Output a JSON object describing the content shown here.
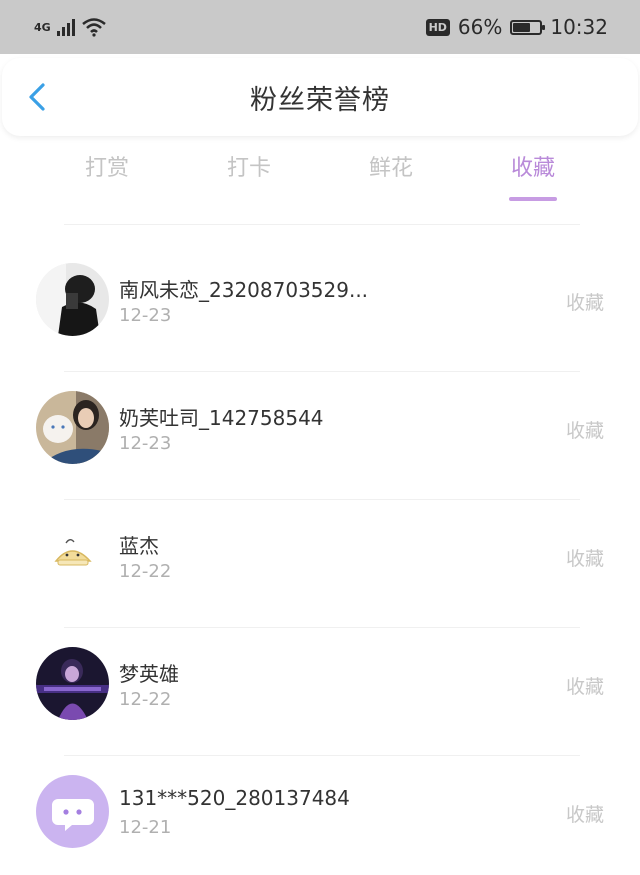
{
  "status_bar": {
    "network": "4G",
    "signal_icon": "signal-icon",
    "wifi_icon": "wifi-icon",
    "hd_badge": "HD",
    "battery_percent": "66%",
    "battery_level": 0.66,
    "time": "10:32"
  },
  "header": {
    "title": "粉丝荣誉榜",
    "back_icon": "chevron-left-icon"
  },
  "tabs": [
    {
      "label": "打赏",
      "active": false
    },
    {
      "label": "打卡",
      "active": false
    },
    {
      "label": "鲜花",
      "active": false
    },
    {
      "label": "收藏",
      "active": true
    }
  ],
  "fans": [
    {
      "name": "南风未恋_23208703529...",
      "date": "12-23",
      "action": "收藏",
      "avatar": "avatar-photo"
    },
    {
      "name": "奶芙吐司_142758544",
      "date": "12-23",
      "action": "收藏",
      "avatar": "avatar-photo"
    },
    {
      "name": "蓝杰",
      "date": "12-22",
      "action": "收藏",
      "avatar": "avatar-cartoon"
    },
    {
      "name": "梦英雄",
      "date": "12-22",
      "action": "收藏",
      "avatar": "avatar-photo"
    },
    {
      "name": "131***520_280137484",
      "date": "12-21",
      "action": "收藏",
      "avatar": "default-avatar-icon"
    }
  ],
  "colors": {
    "accent": "#b98ad9",
    "status_bar_bg": "#c9c9c9",
    "back_arrow": "#3aa0e6"
  }
}
